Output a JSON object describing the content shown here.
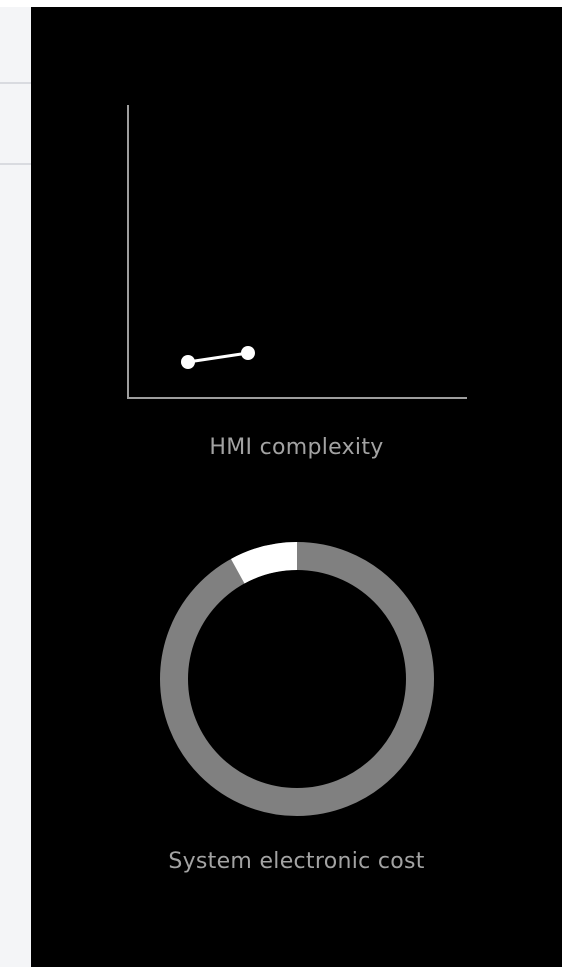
{
  "hmi_chart": {
    "label": "HMI complexity",
    "points": [
      {
        "x": 1,
        "y": 1
      },
      {
        "x": 2,
        "y": 1.25
      }
    ],
    "axis_color": "#9e9e9e",
    "line_color": "#ffffff"
  },
  "cost_gauge": {
    "label": "System electronic cost",
    "highlight_fraction": 0.08,
    "ring_color": "#808080",
    "highlight_color": "#ffffff"
  },
  "colors": {
    "panel_background": "#000000",
    "left_background": "#f4f5f7",
    "label_color": "#a3a3a3"
  }
}
